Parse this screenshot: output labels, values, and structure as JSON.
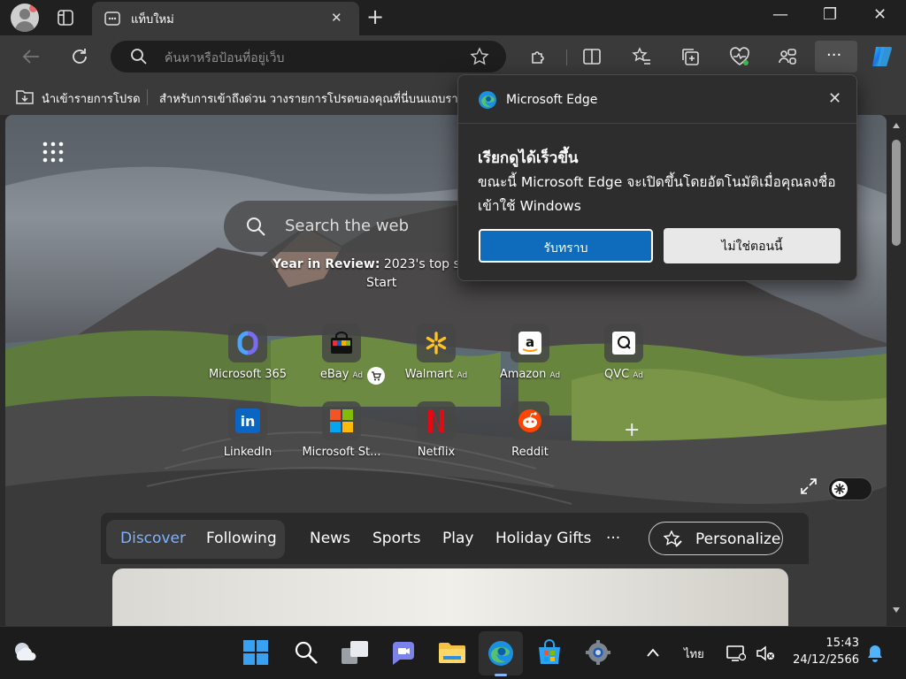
{
  "window": {
    "tab_title": "แท็บใหม่",
    "tab_close": "✕",
    "new_tab": "+",
    "minimize": "—",
    "restore": "❐",
    "close": "✕"
  },
  "toolbar": {
    "address_placeholder": "ค้นหาหรือป้อนที่อยู่เว็บ",
    "more_label": "···"
  },
  "favorites_bar": {
    "import_label": "นำเข้ารายการโปรด",
    "hint": "สำหรับการเข้าถึงด่วน วางรายการโปรดของคุณที่นี่บนแถบรายการ"
  },
  "newtab": {
    "search_placeholder": "Search the web",
    "year_review_bold": "Year in Review:",
    "year_review_text": " 2023's top storie",
    "year_review_line2": "Start",
    "ad_label": "Ad",
    "quick_links": [
      {
        "label": "Microsoft 365",
        "ad": false,
        "icon": "microsoft-365-icon"
      },
      {
        "label": "eBay",
        "ad": true,
        "icon": "ebay-icon"
      },
      {
        "label": "Walmart",
        "ad": true,
        "icon": "walmart-icon"
      },
      {
        "label": "Amazon",
        "ad": true,
        "icon": "amazon-icon"
      },
      {
        "label": "QVC",
        "ad": true,
        "icon": "qvc-icon"
      },
      {
        "label": "LinkedIn",
        "ad": false,
        "icon": "linkedin-icon"
      },
      {
        "label": "Microsoft St...",
        "ad": false,
        "icon": "microsoft-store-icon"
      },
      {
        "label": "Netflix",
        "ad": false,
        "icon": "netflix-icon"
      },
      {
        "label": "Reddit",
        "ad": false,
        "icon": "reddit-icon"
      }
    ],
    "add_shortcut": "+",
    "nav": {
      "discover": "Discover",
      "following": "Following",
      "news": "News",
      "sports": "Sports",
      "play": "Play",
      "holiday": "Holiday Gifts",
      "more": "···",
      "personalize": "Personalize"
    }
  },
  "popup": {
    "app_name": "Microsoft Edge",
    "heading": "เรียกดูได้เร็วขึ้น",
    "body": "ขณะนี้ Microsoft Edge จะเปิดขึ้นโดยอัตโนมัติเมื่อคุณลงชื่อเข้าใช้ Windows",
    "accept": "รับทราบ",
    "decline": "ไม่ใช่ตอนนี้"
  },
  "taskbar": {
    "language": "ไทย",
    "time": "15:43",
    "date": "24/12/2566"
  },
  "colors": {
    "accent": "#0f6cbd",
    "discover": "#7fb2ff"
  }
}
